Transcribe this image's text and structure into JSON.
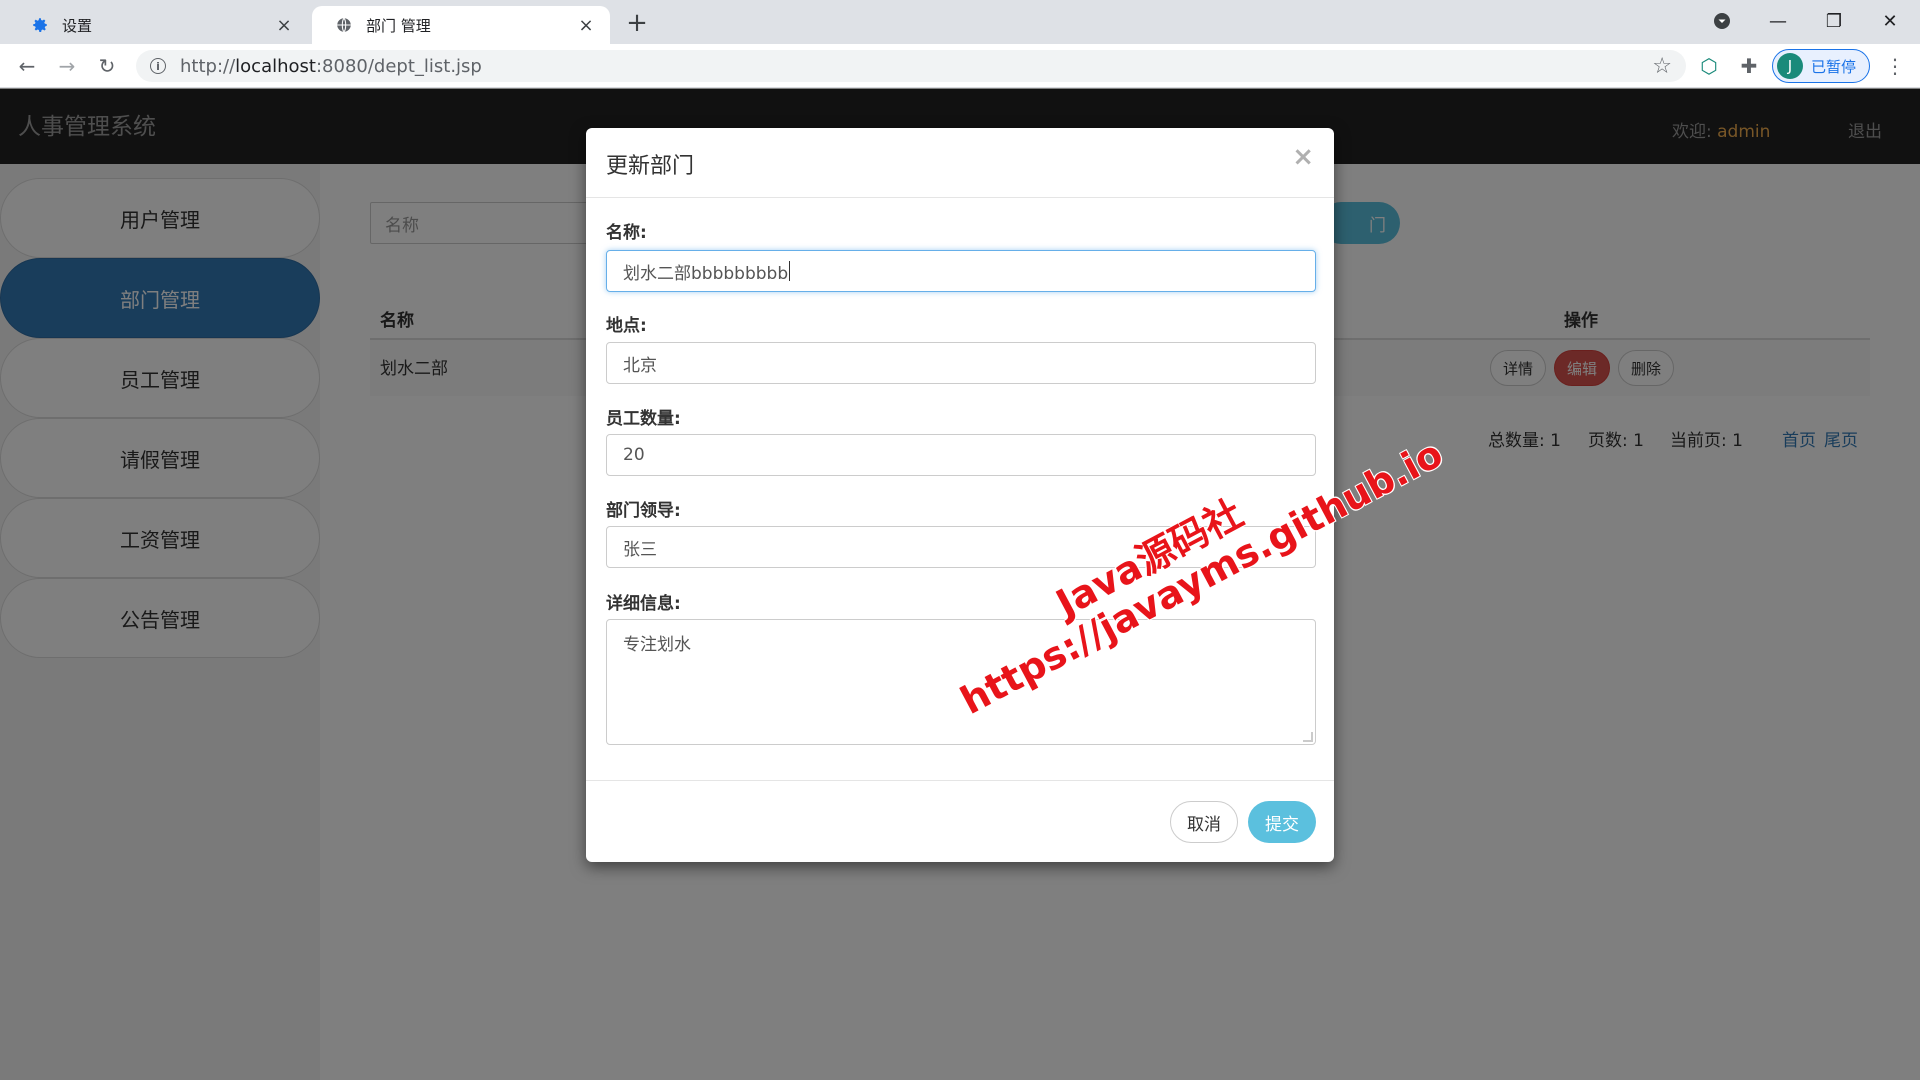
{
  "browser": {
    "tabs": [
      {
        "title": "设置",
        "icon": "gear-icon"
      },
      {
        "title": "部门 管理",
        "icon": "globe-icon"
      }
    ],
    "url_prefix": "http://",
    "url_host": "localhost",
    "url_path": ":8080/dept_list.jsp",
    "profile_initial": "J",
    "profile_label": "已暂停"
  },
  "header": {
    "brand": "人事管理系统",
    "welcome_label": "欢迎: ",
    "username": "admin",
    "logout": "退出"
  },
  "sidebar": {
    "items": [
      {
        "label": "用户管理"
      },
      {
        "label": "部门管理",
        "active": true
      },
      {
        "label": "员工管理"
      },
      {
        "label": "请假管理"
      },
      {
        "label": "工资管理"
      },
      {
        "label": "公告管理"
      }
    ]
  },
  "main": {
    "search_placeholder": "名称",
    "add_button_visible_text": "门",
    "table": {
      "headers": [
        "名称",
        "操作"
      ],
      "rows": [
        {
          "name": "划水二部",
          "actions": [
            "详情",
            "编辑",
            "删除"
          ]
        }
      ]
    },
    "pager": {
      "total_label": "总数量: 1",
      "pages_label": "页数: 1",
      "current_label": "当前页: 1",
      "first": "首页",
      "last": "尾页"
    }
  },
  "modal": {
    "title": "更新部门",
    "close": "×",
    "fields": {
      "name_label": "名称:",
      "name_value": "划水二部bbbbbbbbb",
      "location_label": "地点:",
      "location_value": "北京",
      "count_label": "员工数量:",
      "count_value": "20",
      "leader_label": "部门领导:",
      "leader_value": "张三",
      "detail_label": "详细信息:",
      "detail_value": "专注划水"
    },
    "cancel": "取消",
    "submit": "提交"
  },
  "watermark": {
    "line1": "Java源码社",
    "line2": "https://javayms.github.io"
  },
  "colors": {
    "primary": "#337ab7",
    "info": "#5bc0de",
    "danger": "#d9534f",
    "navbar": "#222222",
    "watermark": "#e8141a"
  }
}
